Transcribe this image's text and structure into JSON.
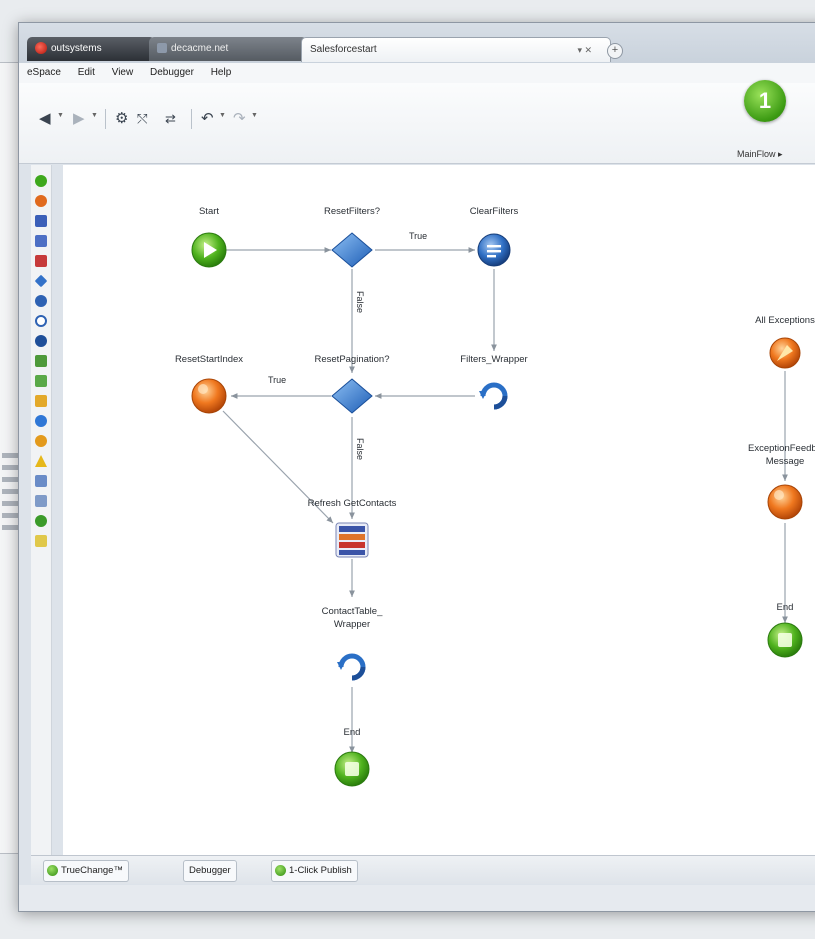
{
  "window": {
    "tabs": [
      {
        "label": "outsystems",
        "active": false
      },
      {
        "label": "decacme.net",
        "active": false
      },
      {
        "label": "Salesforcestart",
        "active": true
      }
    ],
    "menu": [
      "eSpace",
      "Edit",
      "View",
      "Debugger",
      "Help"
    ],
    "toolbar_icons": [
      "back-arrow",
      "forward-arrow",
      "gear",
      "flow-connect",
      "flow-split",
      "undo",
      "redo"
    ],
    "step_badge": "1",
    "flow_name": "MainFlow ▸"
  },
  "flow": {
    "nodes": {
      "start": "Start",
      "reset_filters": "ResetFilters?",
      "clear_filters": "ClearFilters",
      "reset_start_index": "ResetStartIndex",
      "reset_pagination": "ResetPagination?",
      "filters_wrapper": "Filters_Wrapper",
      "refresh_get_contacts": "Refresh GetContacts",
      "contact_table_wrapper_line1": "ContactTable_",
      "contact_table_wrapper_line2": "Wrapper",
      "end": "End",
      "all_exceptions": "All Exceptions",
      "exception_feedback_line1": "ExceptionFeedba",
      "exception_feedback_line2": "Message",
      "exception_end": "End"
    },
    "edges": {
      "true_1": "True",
      "false_1": "False",
      "true_2": "True",
      "false_2": "False"
    }
  },
  "status_tabs": [
    {
      "label": "TrueChange™"
    },
    {
      "label": "Debugger"
    },
    {
      "label": "1-Click Publish"
    }
  ]
}
